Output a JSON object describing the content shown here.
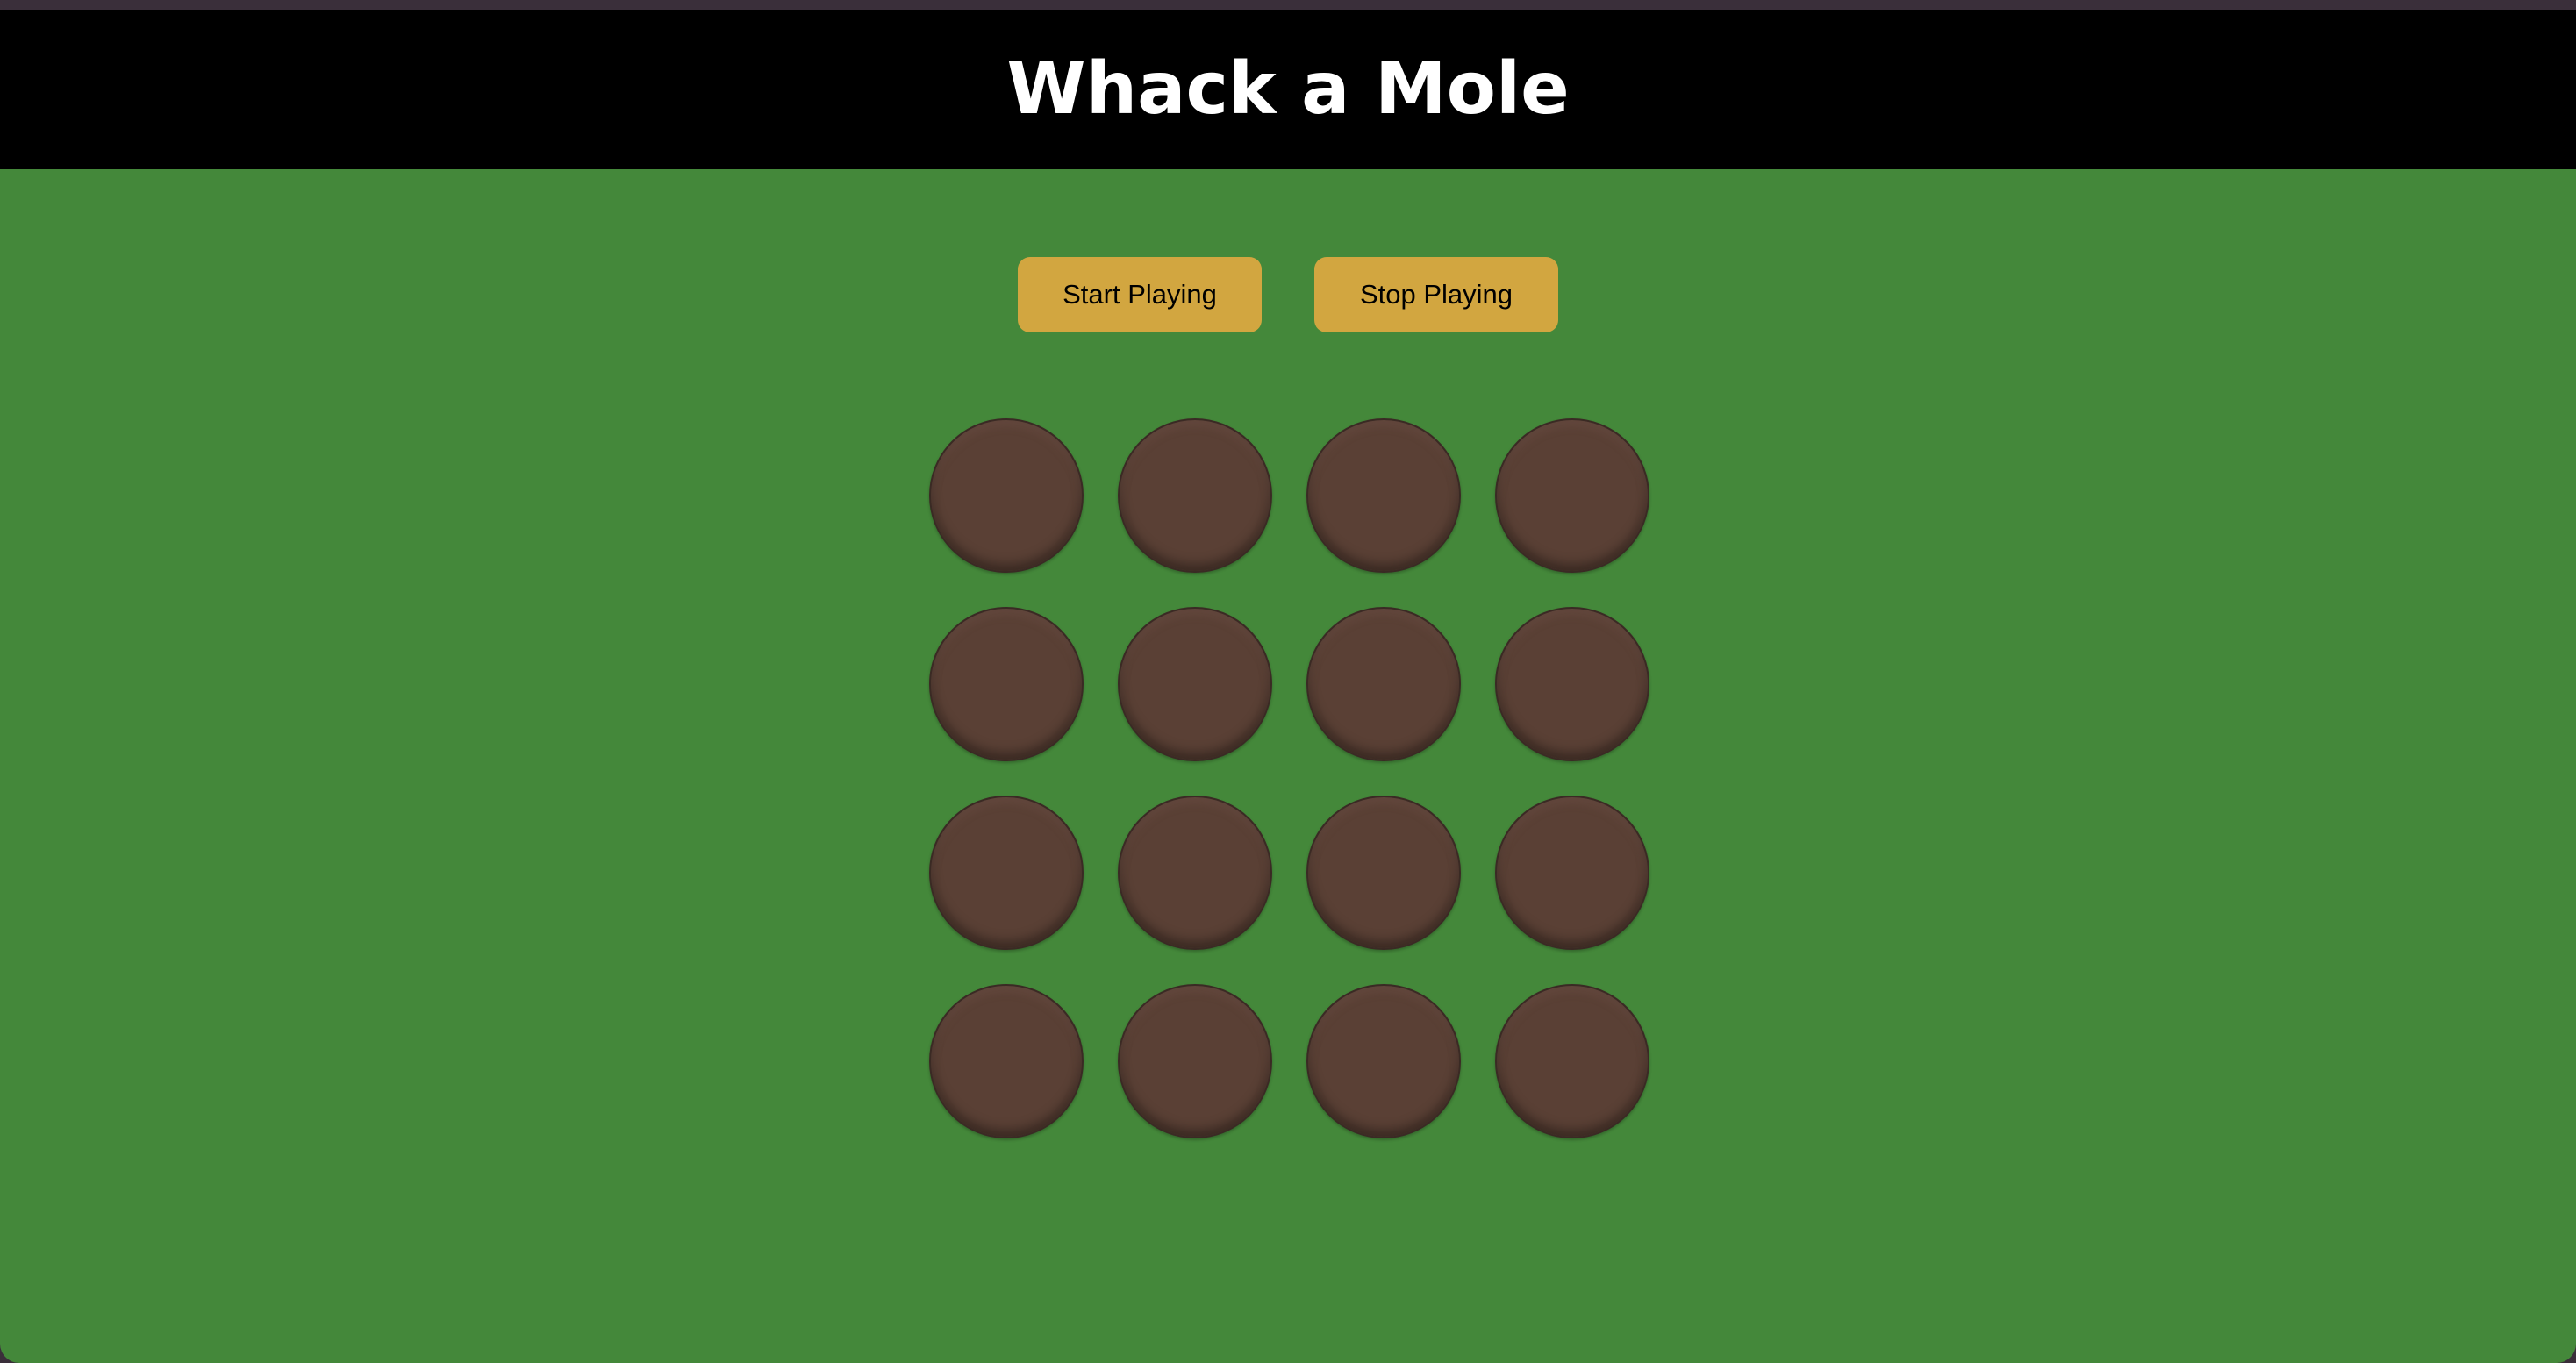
{
  "header": {
    "title": "Whack a Mole"
  },
  "controls": {
    "start_label": "Start Playing",
    "stop_label": "Stop Playing"
  },
  "board": {
    "rows": 4,
    "columns": 4
  },
  "colors": {
    "background": "#44883a",
    "header": "#000000",
    "button": "#d2a640",
    "hole": "#5a4035"
  }
}
